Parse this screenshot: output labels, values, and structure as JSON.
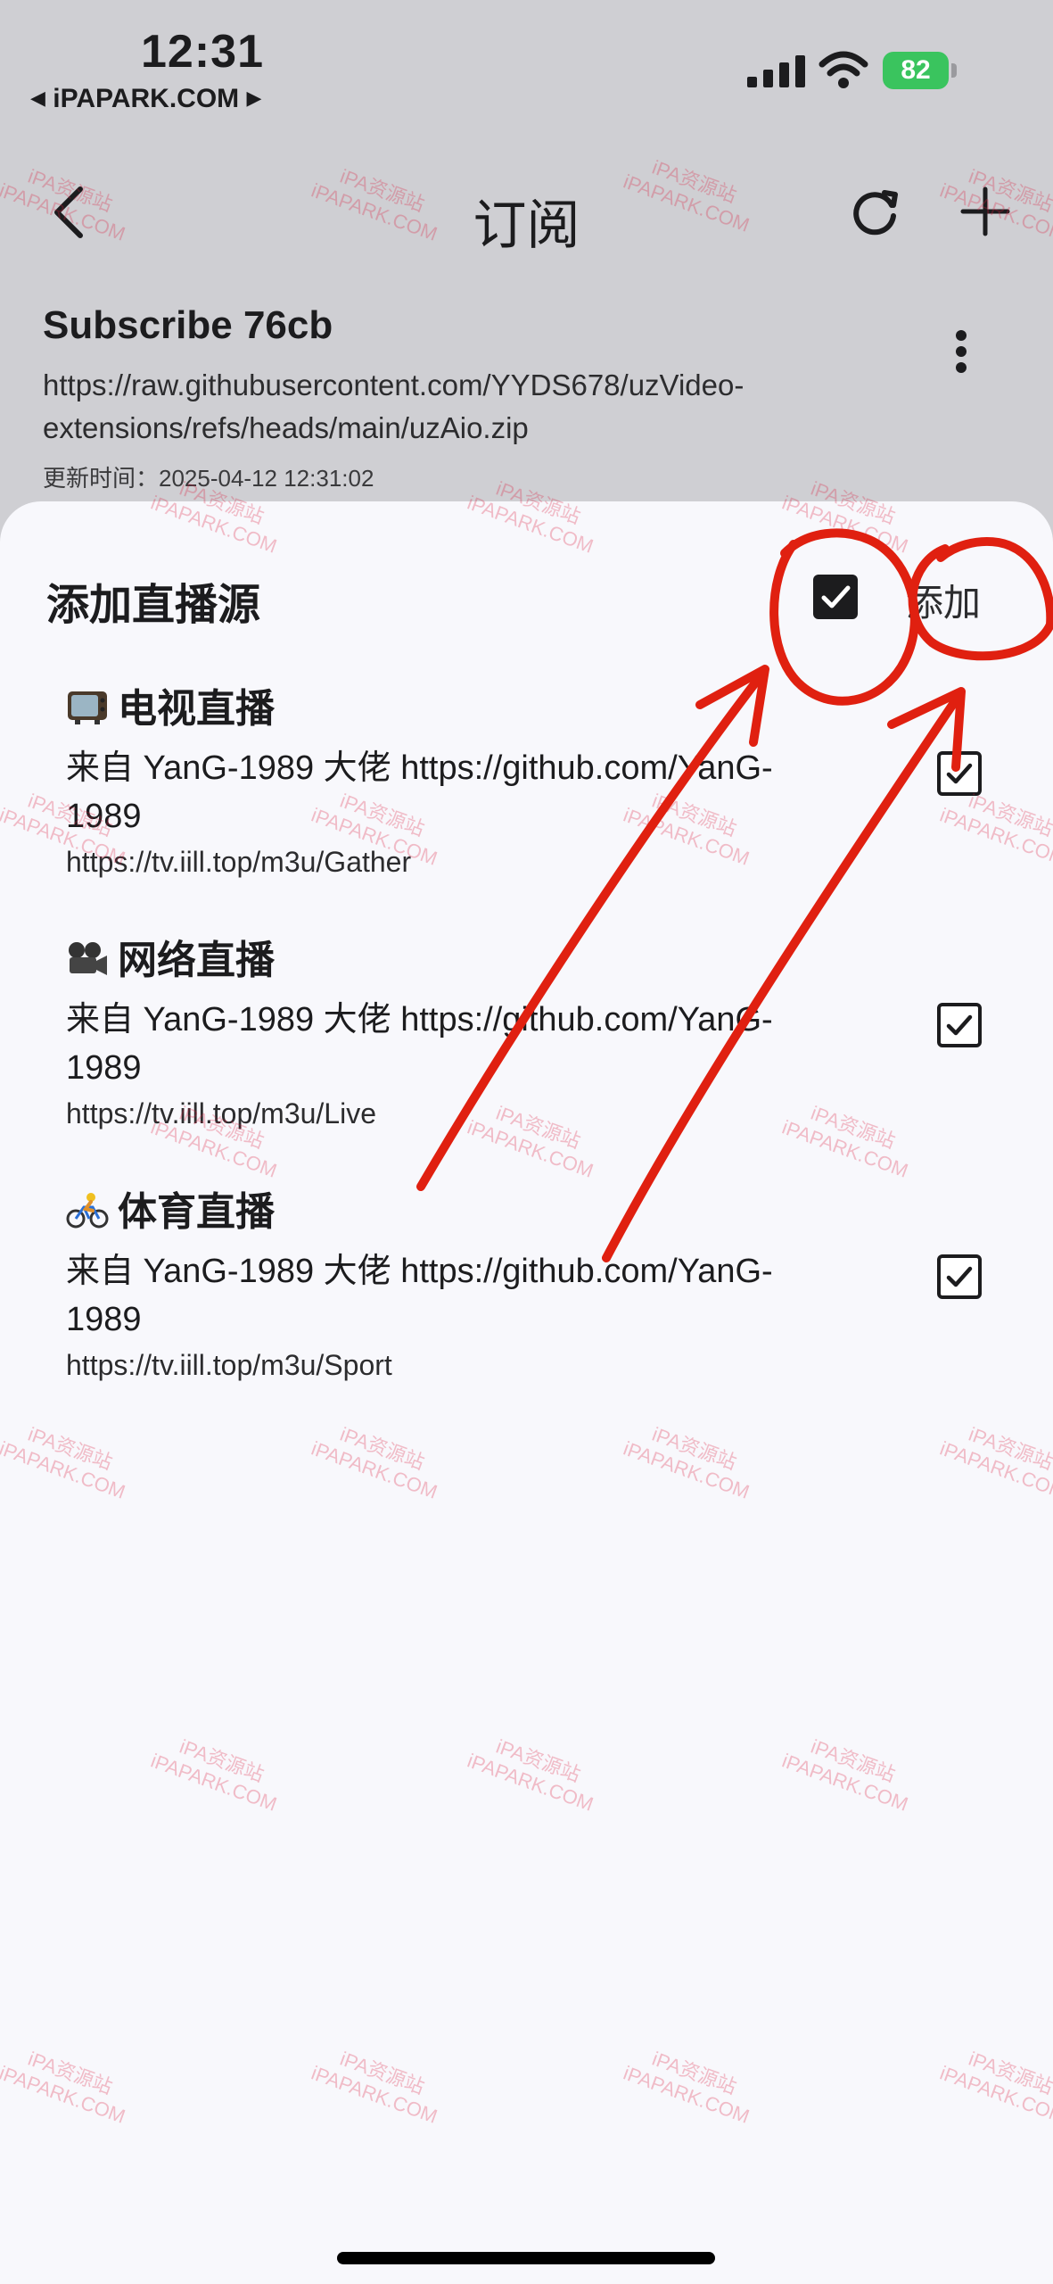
{
  "status_bar": {
    "time": "12:31",
    "carrier": "iPAPARK.COM",
    "battery": "82"
  },
  "nav": {
    "title": "订阅"
  },
  "subscription": {
    "name": "Subscribe 76cb",
    "url": "https://raw.githubusercontent.com/YYDS678/uzVideo-extensions/refs/heads/main/uzAio.zip",
    "updated": "更新时间：2025-04-12 12:31:02"
  },
  "sheet": {
    "title": "添加直播源",
    "add_label": "添加",
    "select_all_checked": true,
    "sources": [
      {
        "icon": "tv-icon",
        "name": "电视直播",
        "desc": "来自 YanG-1989 大佬 https://github.com/YanG-1989",
        "url": "https://tv.iill.top/m3u/Gather",
        "checked": true
      },
      {
        "icon": "movie-camera-icon",
        "name": "网络直播",
        "desc": "来自 YanG-1989 大佬 https://github.com/YanG-1989",
        "url": "https://tv.iill.top/m3u/Live",
        "checked": true
      },
      {
        "icon": "cyclist-icon",
        "name": "体育直播",
        "desc": "来自 YanG-1989 大佬 https://github.com/YanG-1989",
        "url": "https://tv.iill.top/m3u/Sport",
        "checked": true
      }
    ]
  },
  "watermark": {
    "line1": "iPA资源站",
    "line2": "iPAPARK.COM"
  },
  "colors": {
    "annotation": "#e02010",
    "battery": "#3ac45e"
  }
}
